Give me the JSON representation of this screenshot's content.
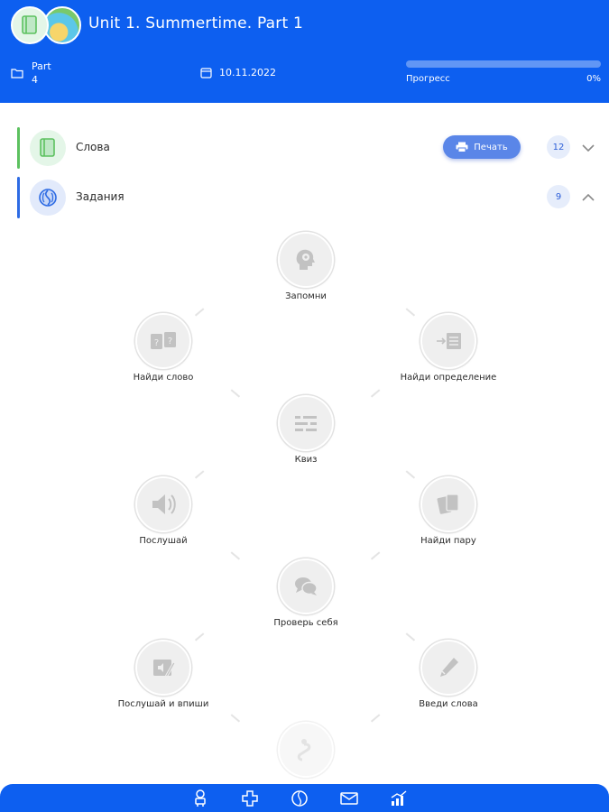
{
  "header": {
    "title": "Unit 1. Summertime. Part 1",
    "part_label": "Part",
    "part_number": "4",
    "date": "10.11.2022",
    "progress_label": "Прогресс",
    "progress_value": "0%",
    "progress_fraction": 0
  },
  "sections": {
    "words": {
      "label": "Слова",
      "print_label": "Печать",
      "count": "12",
      "accent": "#5cc15f"
    },
    "tasks": {
      "label": "Задания",
      "count": "9",
      "accent": "#2d6be4"
    }
  },
  "tasks": [
    {
      "label": "Запомни",
      "icon": "brain-icon"
    },
    {
      "label": "Найди слово",
      "icon": "question-cards-icon"
    },
    {
      "label": "Найди определение",
      "icon": "definition-icon"
    },
    {
      "label": "Квиз",
      "icon": "quiz-icon"
    },
    {
      "label": "Послушай",
      "icon": "speaker-icon"
    },
    {
      "label": "Найди пару",
      "icon": "pair-cards-icon"
    },
    {
      "label": "Проверь себя",
      "icon": "chat-bubbles-icon"
    },
    {
      "label": "Послушай и впиши",
      "icon": "listen-write-icon"
    },
    {
      "label": "Введи слова",
      "icon": "pen-icon"
    },
    {
      "label": "",
      "icon": "locked-task-icon"
    }
  ],
  "bottom_nav": [
    "robot-icon",
    "plus-icon",
    "brain-tab-icon",
    "mail-icon",
    "stats-icon"
  ],
  "colors": {
    "brand": "#0d5ff0",
    "print_button": "#5a86e8"
  }
}
